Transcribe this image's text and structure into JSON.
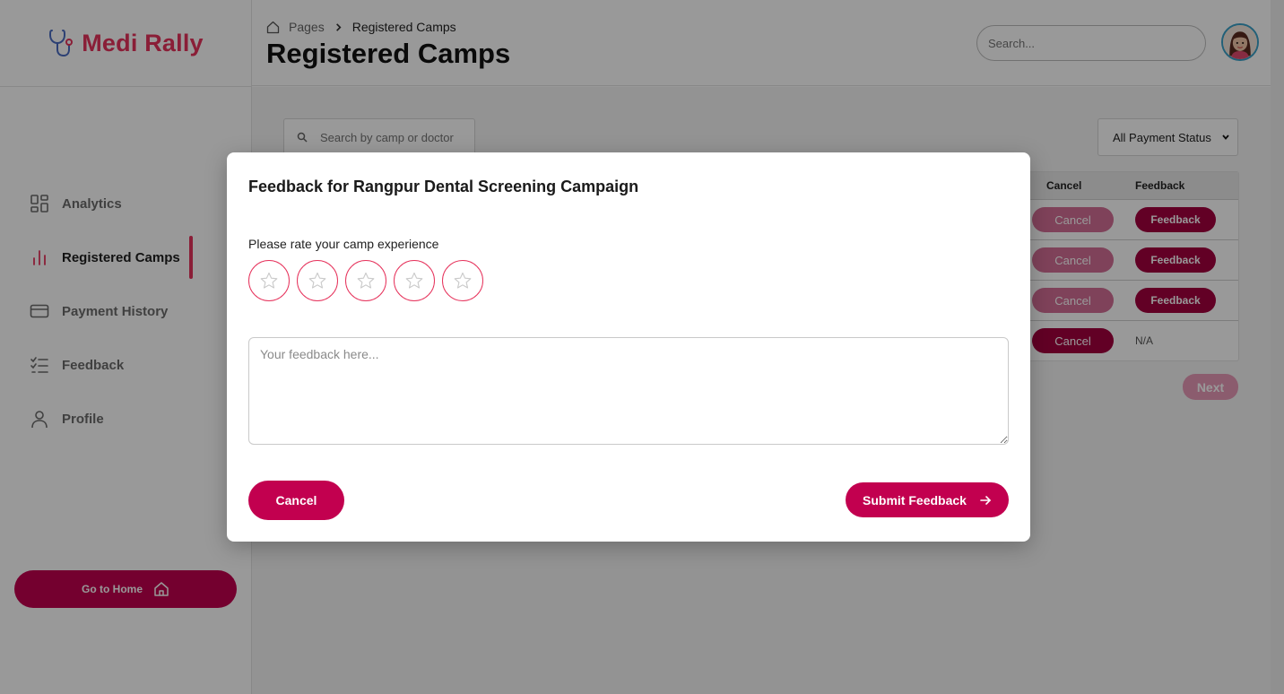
{
  "brand": {
    "name": "Medi Rally",
    "color": "#e6335c"
  },
  "sidebar": {
    "items": [
      {
        "label": "Analytics",
        "icon": "dashboard-grid-icon"
      },
      {
        "label": "Registered Camps",
        "icon": "bar-chart-icon",
        "active": true
      },
      {
        "label": "Payment History",
        "icon": "credit-card-icon"
      },
      {
        "label": "Feedback",
        "icon": "checklist-icon"
      },
      {
        "label": "Profile",
        "icon": "user-icon"
      }
    ],
    "home_button": "Go to Home"
  },
  "header": {
    "breadcrumb": [
      "Pages",
      "Registered Camps"
    ],
    "title": "Registered Camps",
    "search_placeholder": "Search..."
  },
  "main": {
    "search_placeholder": "Search by camp or doctor",
    "payment_filter": "All Payment Status",
    "table": {
      "headers": [
        "Cancel",
        "Feedback"
      ],
      "rows": [
        {
          "cancel": "Cancel",
          "feedback": "Feedback"
        },
        {
          "cancel": "Cancel",
          "feedback": "Feedback"
        },
        {
          "cancel": "Cancel",
          "feedback": "Feedback"
        },
        {
          "cancel": "Cancel",
          "feedback": "N/A"
        }
      ]
    },
    "next_label": "Next"
  },
  "modal": {
    "title": "Feedback for Rangpur Dental Screening Campaign",
    "rating_label": "Please rate your camp experience",
    "rating": 0,
    "max_rating": 5,
    "feedback_placeholder": "Your feedback here...",
    "cancel_label": "Cancel",
    "submit_label": "Submit Feedback"
  },
  "colors": {
    "accent": "#c2004f",
    "accent_dark": "#a3003f",
    "star_border": "#e6335c"
  }
}
